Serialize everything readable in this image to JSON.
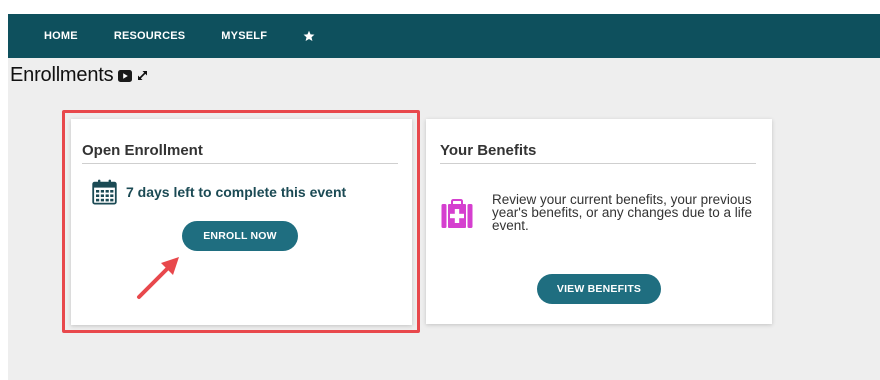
{
  "nav": {
    "items": [
      "HOME",
      "RESOURCES",
      "MYSELF"
    ],
    "star_icon": "star-icon",
    "bg_color": "#0e505d"
  },
  "page": {
    "title": "Enrollments",
    "video_icon": "video-icon",
    "expand_icon": "expand-icon"
  },
  "open_enrollment": {
    "title": "Open Enrollment",
    "calendar_icon": "calendar-icon",
    "days_left_text": "7 days left to complete this event",
    "enroll_button": "ENROLL NOW",
    "highlight_color": "#e8484c"
  },
  "benefits": {
    "title": "Your Benefits",
    "icon": "first-aid-kit-icon",
    "icon_color": "#d53fcf",
    "description": "Review your current benefits, your previous year's benefits, or any changes due to a life event.",
    "view_button": "VIEW BENEFITS"
  },
  "accent_color": "#1f6e80"
}
